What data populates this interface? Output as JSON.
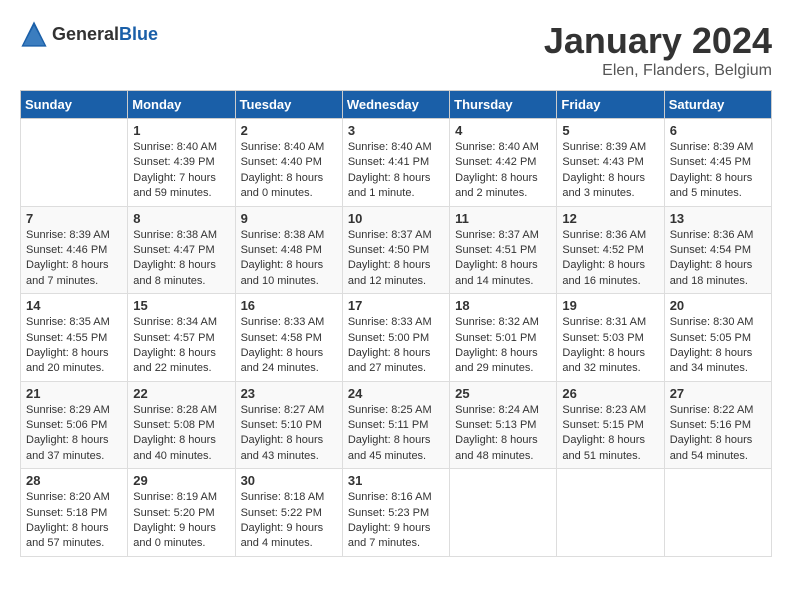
{
  "header": {
    "logo_general": "General",
    "logo_blue": "Blue",
    "month_title": "January 2024",
    "location": "Elen, Flanders, Belgium"
  },
  "days_of_week": [
    "Sunday",
    "Monday",
    "Tuesday",
    "Wednesday",
    "Thursday",
    "Friday",
    "Saturday"
  ],
  "weeks": [
    [
      {
        "day": "",
        "sunrise": "",
        "sunset": "",
        "daylight": ""
      },
      {
        "day": "1",
        "sunrise": "Sunrise: 8:40 AM",
        "sunset": "Sunset: 4:39 PM",
        "daylight": "Daylight: 7 hours and 59 minutes."
      },
      {
        "day": "2",
        "sunrise": "Sunrise: 8:40 AM",
        "sunset": "Sunset: 4:40 PM",
        "daylight": "Daylight: 8 hours and 0 minutes."
      },
      {
        "day": "3",
        "sunrise": "Sunrise: 8:40 AM",
        "sunset": "Sunset: 4:41 PM",
        "daylight": "Daylight: 8 hours and 1 minute."
      },
      {
        "day": "4",
        "sunrise": "Sunrise: 8:40 AM",
        "sunset": "Sunset: 4:42 PM",
        "daylight": "Daylight: 8 hours and 2 minutes."
      },
      {
        "day": "5",
        "sunrise": "Sunrise: 8:39 AM",
        "sunset": "Sunset: 4:43 PM",
        "daylight": "Daylight: 8 hours and 3 minutes."
      },
      {
        "day": "6",
        "sunrise": "Sunrise: 8:39 AM",
        "sunset": "Sunset: 4:45 PM",
        "daylight": "Daylight: 8 hours and 5 minutes."
      }
    ],
    [
      {
        "day": "7",
        "sunrise": "Sunrise: 8:39 AM",
        "sunset": "Sunset: 4:46 PM",
        "daylight": "Daylight: 8 hours and 7 minutes."
      },
      {
        "day": "8",
        "sunrise": "Sunrise: 8:38 AM",
        "sunset": "Sunset: 4:47 PM",
        "daylight": "Daylight: 8 hours and 8 minutes."
      },
      {
        "day": "9",
        "sunrise": "Sunrise: 8:38 AM",
        "sunset": "Sunset: 4:48 PM",
        "daylight": "Daylight: 8 hours and 10 minutes."
      },
      {
        "day": "10",
        "sunrise": "Sunrise: 8:37 AM",
        "sunset": "Sunset: 4:50 PM",
        "daylight": "Daylight: 8 hours and 12 minutes."
      },
      {
        "day": "11",
        "sunrise": "Sunrise: 8:37 AM",
        "sunset": "Sunset: 4:51 PM",
        "daylight": "Daylight: 8 hours and 14 minutes."
      },
      {
        "day": "12",
        "sunrise": "Sunrise: 8:36 AM",
        "sunset": "Sunset: 4:52 PM",
        "daylight": "Daylight: 8 hours and 16 minutes."
      },
      {
        "day": "13",
        "sunrise": "Sunrise: 8:36 AM",
        "sunset": "Sunset: 4:54 PM",
        "daylight": "Daylight: 8 hours and 18 minutes."
      }
    ],
    [
      {
        "day": "14",
        "sunrise": "Sunrise: 8:35 AM",
        "sunset": "Sunset: 4:55 PM",
        "daylight": "Daylight: 8 hours and 20 minutes."
      },
      {
        "day": "15",
        "sunrise": "Sunrise: 8:34 AM",
        "sunset": "Sunset: 4:57 PM",
        "daylight": "Daylight: 8 hours and 22 minutes."
      },
      {
        "day": "16",
        "sunrise": "Sunrise: 8:33 AM",
        "sunset": "Sunset: 4:58 PM",
        "daylight": "Daylight: 8 hours and 24 minutes."
      },
      {
        "day": "17",
        "sunrise": "Sunrise: 8:33 AM",
        "sunset": "Sunset: 5:00 PM",
        "daylight": "Daylight: 8 hours and 27 minutes."
      },
      {
        "day": "18",
        "sunrise": "Sunrise: 8:32 AM",
        "sunset": "Sunset: 5:01 PM",
        "daylight": "Daylight: 8 hours and 29 minutes."
      },
      {
        "day": "19",
        "sunrise": "Sunrise: 8:31 AM",
        "sunset": "Sunset: 5:03 PM",
        "daylight": "Daylight: 8 hours and 32 minutes."
      },
      {
        "day": "20",
        "sunrise": "Sunrise: 8:30 AM",
        "sunset": "Sunset: 5:05 PM",
        "daylight": "Daylight: 8 hours and 34 minutes."
      }
    ],
    [
      {
        "day": "21",
        "sunrise": "Sunrise: 8:29 AM",
        "sunset": "Sunset: 5:06 PM",
        "daylight": "Daylight: 8 hours and 37 minutes."
      },
      {
        "day": "22",
        "sunrise": "Sunrise: 8:28 AM",
        "sunset": "Sunset: 5:08 PM",
        "daylight": "Daylight: 8 hours and 40 minutes."
      },
      {
        "day": "23",
        "sunrise": "Sunrise: 8:27 AM",
        "sunset": "Sunset: 5:10 PM",
        "daylight": "Daylight: 8 hours and 43 minutes."
      },
      {
        "day": "24",
        "sunrise": "Sunrise: 8:25 AM",
        "sunset": "Sunset: 5:11 PM",
        "daylight": "Daylight: 8 hours and 45 minutes."
      },
      {
        "day": "25",
        "sunrise": "Sunrise: 8:24 AM",
        "sunset": "Sunset: 5:13 PM",
        "daylight": "Daylight: 8 hours and 48 minutes."
      },
      {
        "day": "26",
        "sunrise": "Sunrise: 8:23 AM",
        "sunset": "Sunset: 5:15 PM",
        "daylight": "Daylight: 8 hours and 51 minutes."
      },
      {
        "day": "27",
        "sunrise": "Sunrise: 8:22 AM",
        "sunset": "Sunset: 5:16 PM",
        "daylight": "Daylight: 8 hours and 54 minutes."
      }
    ],
    [
      {
        "day": "28",
        "sunrise": "Sunrise: 8:20 AM",
        "sunset": "Sunset: 5:18 PM",
        "daylight": "Daylight: 8 hours and 57 minutes."
      },
      {
        "day": "29",
        "sunrise": "Sunrise: 8:19 AM",
        "sunset": "Sunset: 5:20 PM",
        "daylight": "Daylight: 9 hours and 0 minutes."
      },
      {
        "day": "30",
        "sunrise": "Sunrise: 8:18 AM",
        "sunset": "Sunset: 5:22 PM",
        "daylight": "Daylight: 9 hours and 4 minutes."
      },
      {
        "day": "31",
        "sunrise": "Sunrise: 8:16 AM",
        "sunset": "Sunset: 5:23 PM",
        "daylight": "Daylight: 9 hours and 7 minutes."
      },
      {
        "day": "",
        "sunrise": "",
        "sunset": "",
        "daylight": ""
      },
      {
        "day": "",
        "sunrise": "",
        "sunset": "",
        "daylight": ""
      },
      {
        "day": "",
        "sunrise": "",
        "sunset": "",
        "daylight": ""
      }
    ]
  ]
}
